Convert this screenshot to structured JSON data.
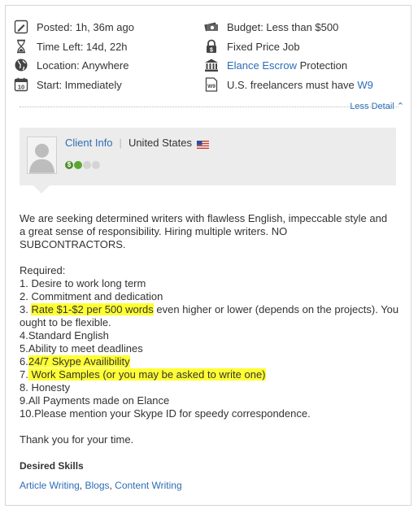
{
  "meta": {
    "posted": "Posted: 1h, 36m ago",
    "time_left": "Time Left: 14d, 22h",
    "location": "Location: Anywhere",
    "start": "Start: Immediately",
    "budget": "Budget: Less than $500",
    "job_type": "Fixed Price Job",
    "escrow_link": "Elance Escrow",
    "escrow_suffix": " Protection",
    "w9_prefix": "U.S. freelancers must have ",
    "w9_link": "W9",
    "calendar_day": "10",
    "w9_icon_text": "W9"
  },
  "less_detail": "Less Detail ⌃",
  "client": {
    "info_link": "Client Info",
    "separator": "|",
    "country": "United States",
    "rating_symbol": "$"
  },
  "description": {
    "intro_1": "We are seeking determined writers with flawless English, impeccable style and",
    "intro_2": "a great sense of responsibility. Hiring multiple writers. NO",
    "intro_3": "SUBCONTRACTORS.",
    "required": "Required:",
    "item_1": "1. Desire to work long term",
    "item_2": "2. Commitment and dedication",
    "item_3_prefix": "3. ",
    "item_3_highlight": "Rate $1-$2 per 500 words",
    "item_3_rest": " even higher or lower (depends on the projects). You",
    "item_3_cont": "ought to be flexible.",
    "item_4": "4.Standard English",
    "item_5": "5.Ability to meet deadlines",
    "item_6_prefix": "6.",
    "item_6_highlight": "24/7 Skype Availibility",
    "item_7_prefix": "7.",
    "item_7_highlight": " Work Samples (or you may be asked to write one)",
    "item_8": "8. Honesty",
    "item_9": "9.All Payments made on Elance",
    "item_10": "10.Please mention your Skype ID for speedy correspondence.",
    "thanks": "Thank you for your time."
  },
  "skills": {
    "title": "Desired Skills",
    "items": [
      "Article Writing",
      "Blogs",
      "Content Writing"
    ],
    "separator": ", "
  },
  "colors": {
    "link": "#2c6db5",
    "highlight": "#ffff33",
    "client_box": "#ececec",
    "rating_green": "#5aa832"
  }
}
